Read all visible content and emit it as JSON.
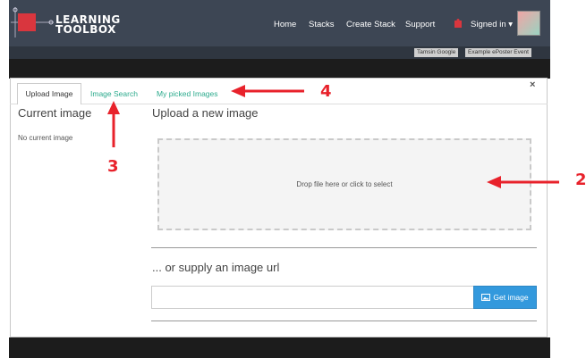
{
  "app": {
    "logo_line1": "LEARNING",
    "logo_line2": "TOOLBOX",
    "nav": {
      "home": "Home",
      "stacks": "Stacks",
      "create_stack": "Create Stack",
      "support": "Support",
      "signed_in": "Signed in ▾"
    },
    "subbar": {
      "user_chip": "Tamsin Google",
      "event_chip": "Example ePoster Event"
    }
  },
  "modal": {
    "tabs": [
      {
        "label": "Upload Image",
        "active": true
      },
      {
        "label": "Image Search",
        "active": false
      },
      {
        "label": "My picked Images",
        "active": false
      }
    ],
    "close": "×",
    "current_title": "Current image",
    "no_current": "No current image",
    "upload_title": "Upload a new image",
    "dropzone_text": "Drop file here or click to select",
    "url_title": "... or supply an image url",
    "url_value": "",
    "get_image_label": "Get image"
  },
  "annotations": {
    "n2": "2",
    "n3": "3",
    "n4": "4"
  },
  "colors": {
    "navbar": "#3d4654",
    "accent_teal": "#2baa8c",
    "button_blue": "#3399dd",
    "annotation_red": "#e8222b",
    "logo_red": "#d9363e"
  }
}
